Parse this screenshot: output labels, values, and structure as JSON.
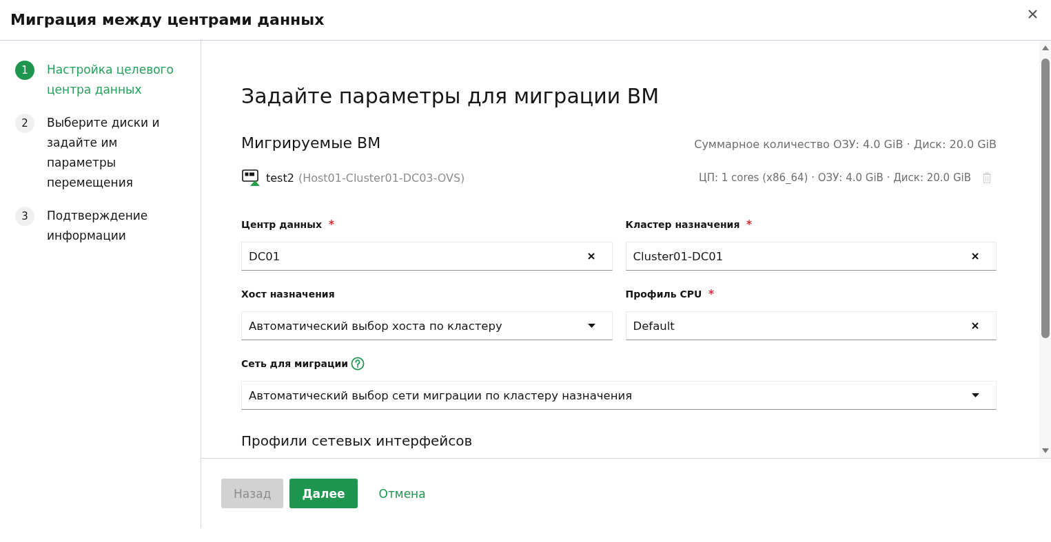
{
  "dialog": {
    "title": "Миграция между центрами данных"
  },
  "steps": [
    {
      "number": "1",
      "label": "Настройка целевого центра данных",
      "selected": true
    },
    {
      "number": "2",
      "label": "Выберите диски и задайте им параметры перемещения",
      "selected": false
    },
    {
      "number": "3",
      "label": "Подтверждение информации",
      "selected": false
    }
  ],
  "page_title": "Задайте параметры для миграции ВМ",
  "vms": {
    "title": "Мигрируемые ВМ",
    "summary": "Суммарное количество ОЗУ: 4.0 GiB · Диск: 20.0 GiB",
    "items": [
      {
        "name": "test2",
        "host": "(Host01-Cluster01-DC03-OVS)",
        "specs": "ЦП: 1 cores (x86_64) · ОЗУ: 4.0 GiB · Диск: 20.0 GiB",
        "running": true,
        "removable": false
      }
    ]
  },
  "form": {
    "rows": [
      {
        "fields": [
          {
            "label": "Центр данных",
            "required": true,
            "help": false,
            "kind": "clearable",
            "value": "DC01"
          },
          {
            "label": "Кластер назначения",
            "required": true,
            "help": false,
            "kind": "clearable",
            "value": "Cluster01-DC01"
          }
        ]
      },
      {
        "fields": [
          {
            "label": "Хост назначения",
            "required": false,
            "help": false,
            "kind": "select",
            "value": "Автоматический выбор хоста по кластеру"
          },
          {
            "label": "Профиль CPU",
            "required": true,
            "help": false,
            "kind": "clearable",
            "value": "Default"
          }
        ]
      },
      {
        "fields": [
          {
            "label": "Сеть для миграции",
            "required": false,
            "help": true,
            "kind": "select",
            "value": "Автоматический выбор сети миграции по кластеру назначения"
          }
        ]
      }
    ]
  },
  "subsection_title": "Профили сетевых интерфейсов",
  "footer": {
    "buttons": [
      {
        "label": "Назад",
        "kind": "secondary",
        "disabled": true
      },
      {
        "label": "Далее",
        "kind": "primary",
        "disabled": false
      },
      {
        "label": "Отмена",
        "kind": "link",
        "disabled": false
      }
    ]
  }
}
